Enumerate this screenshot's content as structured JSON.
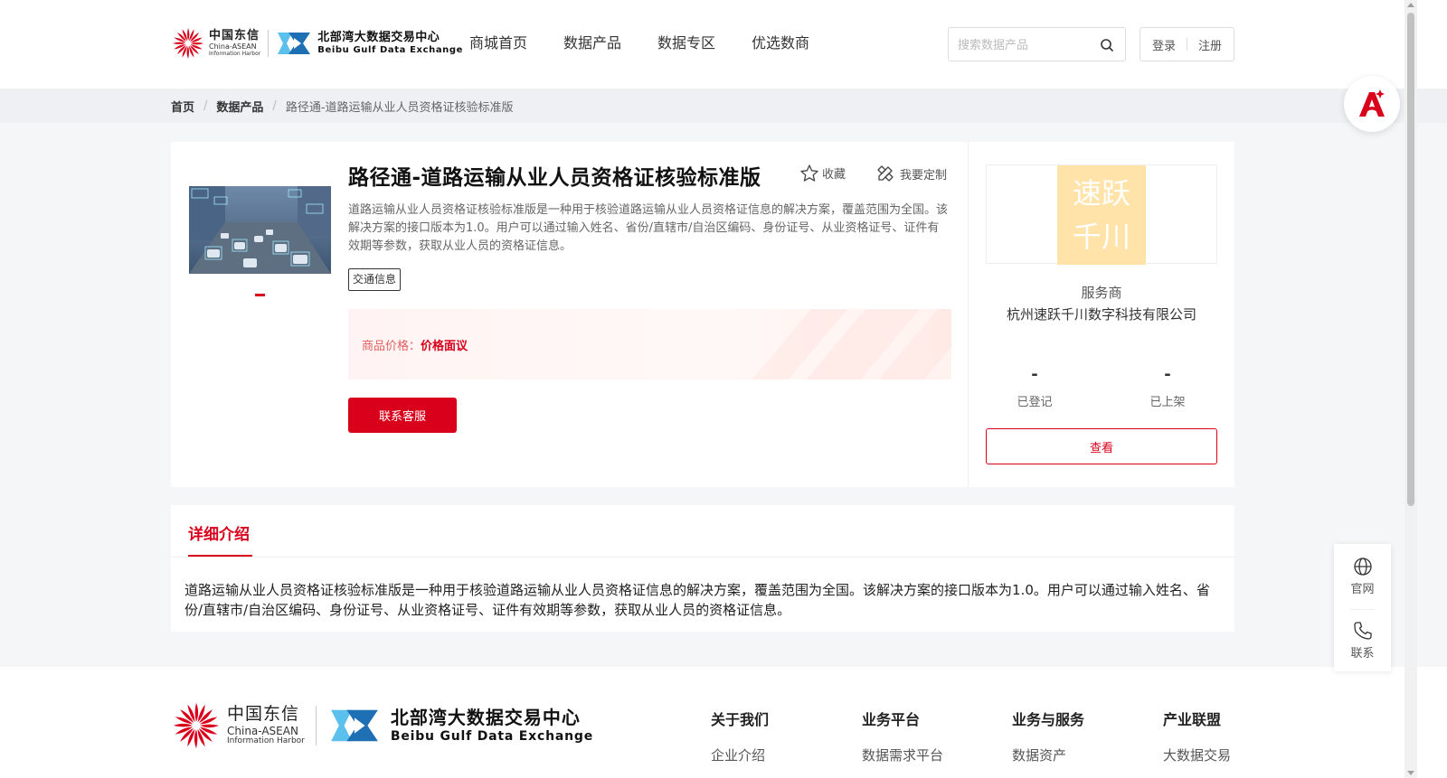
{
  "header": {
    "logo_ct_cn": "中国东信",
    "logo_ct_en1": "China-ASEAN",
    "logo_ct_en2": "Information Harbor",
    "logo_bb_cn": "北部湾大数据交易中心",
    "logo_bb_en": "Beibu Gulf Data Exchange",
    "nav": [
      "商城首页",
      "数据产品",
      "数据专区",
      "优选数商"
    ],
    "search_placeholder": "搜索数据产品",
    "login": "登录",
    "register": "注册"
  },
  "breadcrumb": {
    "home": "首页",
    "category": "数据产品",
    "current": "路径通-道路运输从业人员资格证核验标准版"
  },
  "product": {
    "title": "路径通-道路运输从业人员资格证核验标准版",
    "favorite": "收藏",
    "customize": "我要定制",
    "description": "道路运输从业人员资格证核验标准版是一种用于核验道路运输从业人员资格证信息的解决方案，覆盖范围为全国。该解决方案的接口版本为1.0。用户可以通过输入姓名、省份/直辖市/自治区编码、身份证号、从业资格证号、证件有效期等参数，获取从业人员的资格证信息。",
    "tag": "交通信息",
    "price_label": "商品价格：",
    "price_value": "价格面议",
    "contact_button": "联系客服"
  },
  "vendor": {
    "logo_line1": "速跃",
    "logo_line2": "千川",
    "label": "服务商",
    "name": "杭州速跃千川数字科技有限公司",
    "stat_registered_value": "-",
    "stat_registered_label": "已登记",
    "stat_listed_value": "-",
    "stat_listed_label": "已上架",
    "view_button": "查看"
  },
  "detail": {
    "tab": "详细介绍",
    "body": "道路运输从业人员资格证核验标准版是一种用于核验道路运输从业人员资格证信息的解决方案，覆盖范围为全国。该解决方案的接口版本为1.0。用户可以通过输入姓名、省份/直辖市/自治区编码、身份证号、从业资格证号、证件有效期等参数，获取从业人员的资格证信息。"
  },
  "footer": {
    "columns": [
      {
        "title": "关于我们",
        "item": "企业介绍"
      },
      {
        "title": "业务平台",
        "item": "数据需求平台"
      },
      {
        "title": "业务与服务",
        "item": "数据资产"
      },
      {
        "title": "产业联盟",
        "item": "大数据交易"
      }
    ]
  },
  "side_tools": {
    "website": "官网",
    "contact": "联系"
  },
  "colors": {
    "brand_red": "#d9001b",
    "bb_blue": "#2a9fd8",
    "vendor_logo_bg": "#ffe3a8"
  },
  "icons": [
    "search-icon",
    "star-icon",
    "customize-icon",
    "globe-icon",
    "phone-icon",
    "ai-assistant-icon"
  ]
}
